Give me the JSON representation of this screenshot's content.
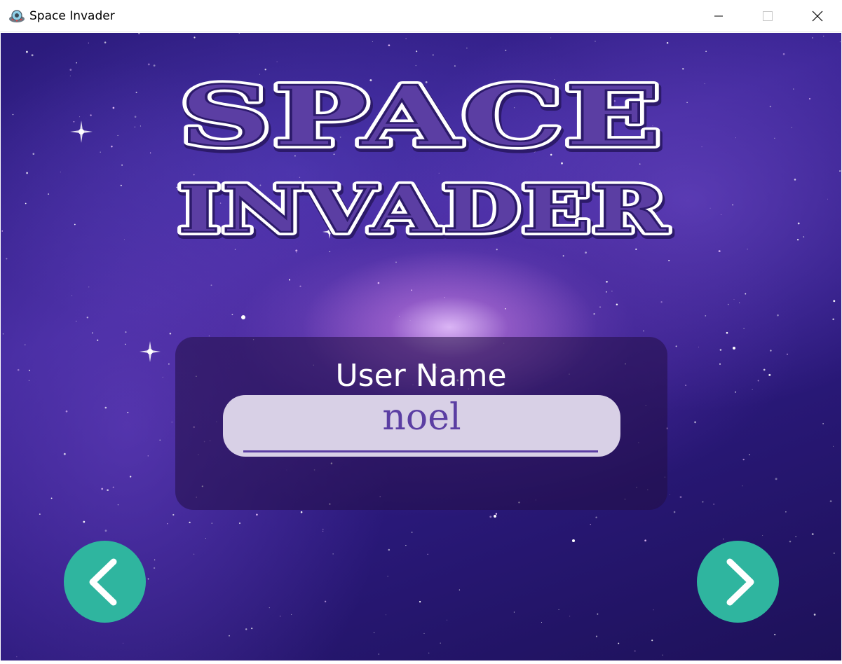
{
  "window": {
    "title": "Space Invader",
    "app_icon": "ufo-icon",
    "controls": [
      "minimize-icon",
      "maximize-icon",
      "close-icon"
    ]
  },
  "game": {
    "logo": {
      "line1": "SPACE",
      "line2": "INVADER"
    },
    "username": {
      "label": "User Name",
      "value": "noel"
    },
    "nav": {
      "back_icon": "chevron-left-icon",
      "next_icon": "chevron-right-icon"
    }
  },
  "colors": {
    "accent": "#2fb59f",
    "logo_fill": "#5b3ea3",
    "input_text": "#5b3ea3",
    "input_bg": "#d8d0e6"
  }
}
